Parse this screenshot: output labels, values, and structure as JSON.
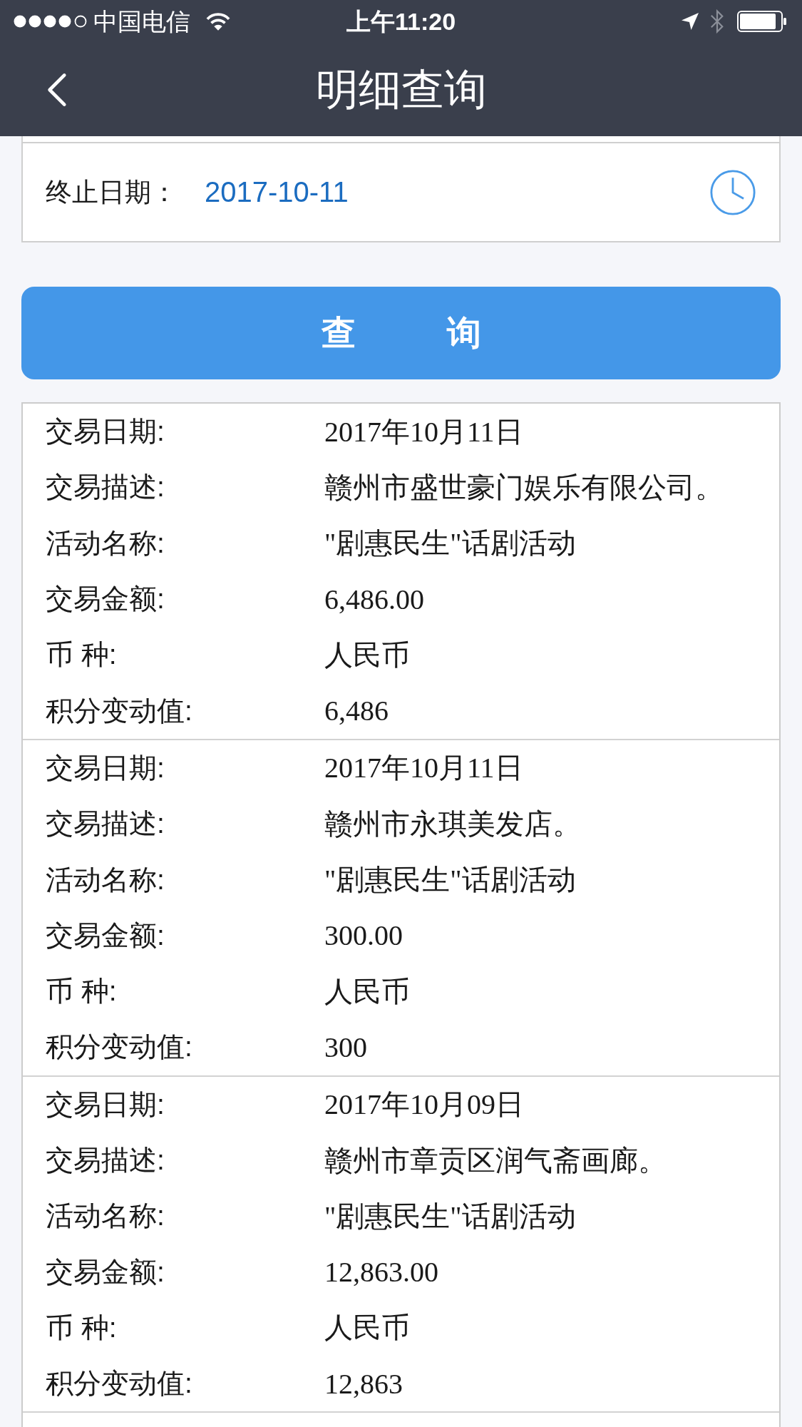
{
  "status_bar": {
    "carrier": "中国电信",
    "time": "上午11:20"
  },
  "nav_bar": {
    "title": "明细查询"
  },
  "date_field": {
    "label": "终止日期：",
    "value": "2017-10-11"
  },
  "query_button": {
    "label": "查　询"
  },
  "records": [
    {
      "fields": [
        {
          "label": "交易日期:",
          "value": "2017年10月11日"
        },
        {
          "label": "交易描述:",
          "value": "赣州市盛世豪门娱乐有限公司。"
        },
        {
          "label": "活动名称:",
          "value": "\"剧惠民生\"话剧活动"
        },
        {
          "label": "交易金额:",
          "value": "6,486.00"
        },
        {
          "label": "币 种:",
          "value": "人民币"
        },
        {
          "label": "积分变动值:",
          "value": "6,486"
        }
      ]
    },
    {
      "fields": [
        {
          "label": "交易日期:",
          "value": "2017年10月11日"
        },
        {
          "label": "交易描述:",
          "value": "赣州市永琪美发店。"
        },
        {
          "label": "活动名称:",
          "value": "\"剧惠民生\"话剧活动"
        },
        {
          "label": "交易金额:",
          "value": "300.00"
        },
        {
          "label": "币 种:",
          "value": "人民币"
        },
        {
          "label": "积分变动值:",
          "value": "300"
        }
      ]
    },
    {
      "fields": [
        {
          "label": "交易日期:",
          "value": "2017年10月09日"
        },
        {
          "label": "交易描述:",
          "value": "赣州市章贡区润气斋画廊。"
        },
        {
          "label": "活动名称:",
          "value": "\"剧惠民生\"话剧活动"
        },
        {
          "label": "交易金额:",
          "value": "12,863.00"
        },
        {
          "label": "币 种:",
          "value": "人民币"
        },
        {
          "label": "积分变动值:",
          "value": "12,863"
        }
      ]
    }
  ]
}
